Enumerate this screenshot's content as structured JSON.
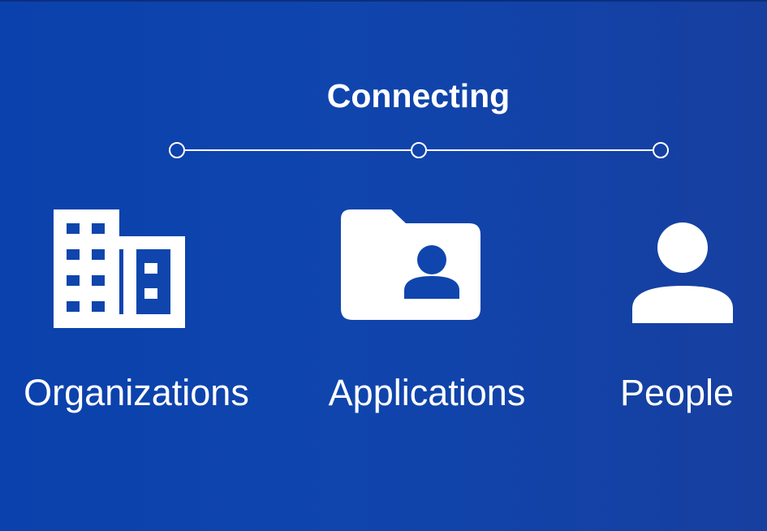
{
  "title": "Connecting",
  "items": [
    {
      "label": "Organizations",
      "icon": "building-icon"
    },
    {
      "label": "Applications",
      "icon": "folder-shared-icon"
    },
    {
      "label": "People",
      "icon": "person-icon"
    }
  ],
  "colors": {
    "background": "#0f45ad",
    "foreground": "#ffffff"
  }
}
